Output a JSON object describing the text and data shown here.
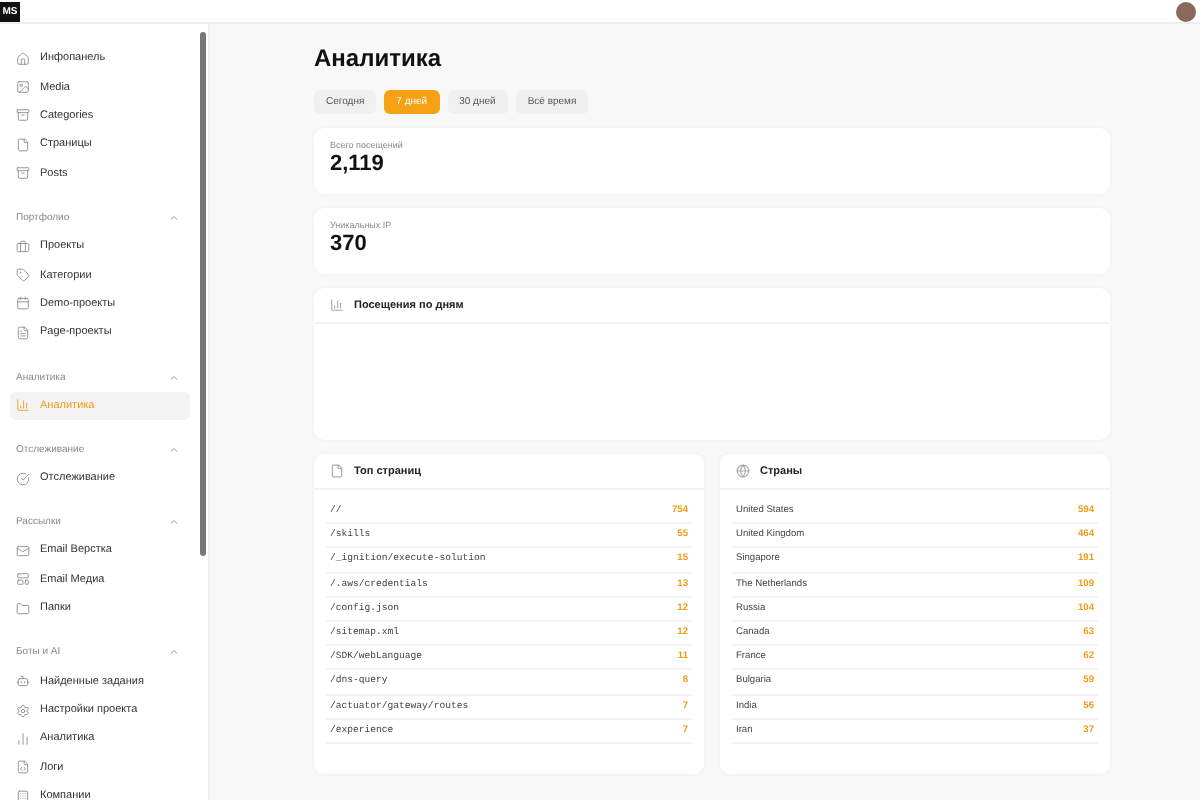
{
  "header": {
    "logo": "MS"
  },
  "sidebar": {
    "sections": [
      {
        "items": [
          {
            "label": "Инфопанель",
            "selected": false
          },
          {
            "label": "Media",
            "selected": false
          },
          {
            "label": "Categories",
            "selected": false
          },
          {
            "label": "Страницы",
            "selected": false
          },
          {
            "label": "Posts",
            "selected": false
          }
        ]
      },
      {
        "title": "Портфолио",
        "expanded": true,
        "items": [
          {
            "label": "Проекты",
            "selected": false
          },
          {
            "label": "Категории",
            "selected": false
          },
          {
            "label": "Demo-проекты",
            "selected": false
          },
          {
            "label": "Page-проекты",
            "selected": false
          }
        ]
      },
      {
        "title": "Аналитика",
        "expanded": true,
        "items": [
          {
            "label": "Аналитика",
            "selected": true
          }
        ]
      },
      {
        "title": "Отслеживание",
        "expanded": true,
        "items": [
          {
            "label": "Отслеживание",
            "selected": false
          }
        ]
      },
      {
        "title": "Рассылки",
        "expanded": true,
        "items": [
          {
            "label": "Email Верстка",
            "selected": false
          },
          {
            "label": "Email Медиа",
            "selected": false
          },
          {
            "label": "Папки",
            "selected": false
          }
        ]
      },
      {
        "title": "Боты и AI",
        "expanded": true,
        "items": [
          {
            "label": "Найденные задания",
            "selected": false
          },
          {
            "label": "Настройки проекта",
            "selected": false
          },
          {
            "label": "Аналитика",
            "selected": false
          },
          {
            "label": "Логи",
            "selected": false
          },
          {
            "label": "Компании",
            "selected": false
          }
        ]
      }
    ]
  },
  "page": {
    "title": "Аналитика",
    "tabs": [
      {
        "label": "Сегодня",
        "selected": false
      },
      {
        "label": "7 дней",
        "selected": true
      },
      {
        "label": "30 дней",
        "selected": false
      },
      {
        "label": "Всё время",
        "selected": false
      }
    ],
    "stats": [
      {
        "label": "Всего посещений",
        "value": "2,119"
      },
      {
        "label": "Уникальных IP",
        "value": "370"
      }
    ],
    "chart": {
      "title": "Посещения по дням"
    },
    "top_pages": {
      "title": "Топ страниц",
      "rows": [
        {
          "path": "//",
          "count": "754"
        },
        {
          "path": "/skills",
          "count": "55"
        },
        {
          "path": "/_ignition/execute-solution",
          "count": "15"
        },
        {
          "path": "/.aws/credentials",
          "count": "13"
        },
        {
          "path": "/config.json",
          "count": "12"
        },
        {
          "path": "/sitemap.xml",
          "count": "12"
        },
        {
          "path": "/SDK/webLanguage",
          "count": "11"
        },
        {
          "path": "/dns-query",
          "count": "8"
        },
        {
          "path": "/actuator/gateway/routes",
          "count": "7"
        },
        {
          "path": "/experience",
          "count": "7"
        }
      ]
    },
    "countries": {
      "title": "Страны",
      "rows": [
        {
          "name": "United States",
          "count": "594"
        },
        {
          "name": "United Kingdom",
          "count": "464"
        },
        {
          "name": "Singapore",
          "count": "191"
        },
        {
          "name": "The Netherlands",
          "count": "109"
        },
        {
          "name": "Russia",
          "count": "104"
        },
        {
          "name": "Canada",
          "count": "63"
        },
        {
          "name": "France",
          "count": "62"
        },
        {
          "name": "Bulgaria",
          "count": "59"
        },
        {
          "name": "India",
          "count": "56"
        },
        {
          "name": "Iran",
          "count": "37"
        }
      ]
    }
  }
}
